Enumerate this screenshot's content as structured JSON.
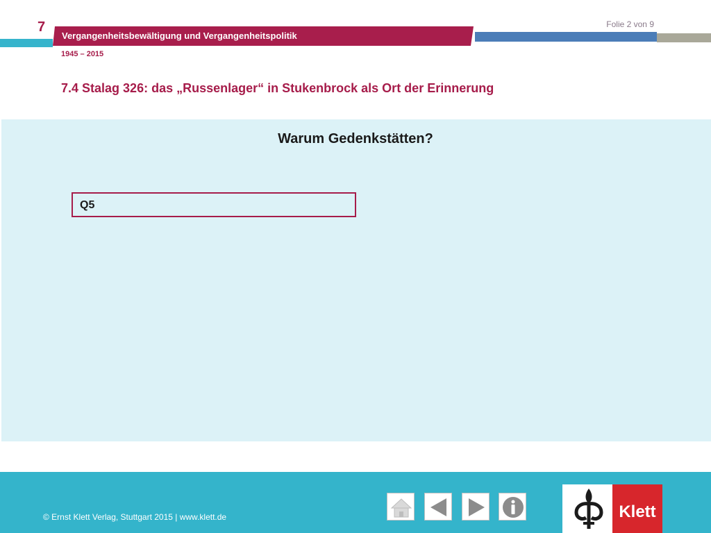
{
  "header": {
    "chapter_number": "7",
    "chapter_title": "Vergangenheitsbewältigung und Vergangenheitspolitik",
    "period": "1945 – 2015",
    "slide_counter": "Folie 2 von 9",
    "section_title": "7.4 Stalag 326: das „Russenlager“ in Stukenbrock als Ort der Erinnerung"
  },
  "content": {
    "heading": "Warum Gedenkstätten?",
    "source_label": "Q5"
  },
  "footer": {
    "copyright": "© Ernst Klett Verlag, Stuttgart 2015 | www.klett.de",
    "nav": [
      {
        "icon": "home-icon"
      },
      {
        "icon": "arrow-left-icon"
      },
      {
        "icon": "arrow-right-icon"
      },
      {
        "icon": "info-icon"
      }
    ],
    "logo_text": "Klett"
  },
  "colors": {
    "accent_red": "#a81e4c",
    "teal": "#34b4cb",
    "panel": "#dcf2f7",
    "blue": "#4b7db8",
    "grey": "#a9a899",
    "klett_red": "#d7262c"
  }
}
